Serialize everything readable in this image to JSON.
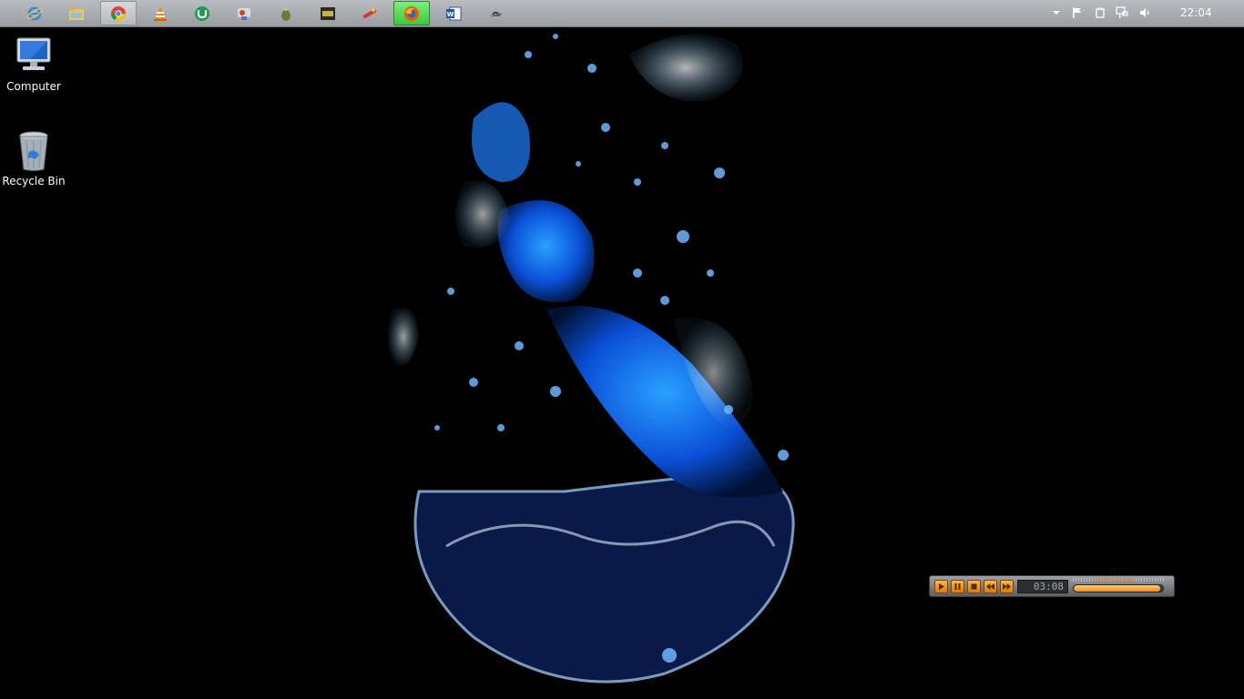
{
  "taskbar": {
    "apps": [
      {
        "name": "internet-explorer",
        "icon": "ie-icon"
      },
      {
        "name": "file-explorer",
        "icon": "folder-icon"
      },
      {
        "name": "chrome",
        "icon": "chrome-icon",
        "active": true
      },
      {
        "name": "vlc",
        "icon": "vlc-cone-icon"
      },
      {
        "name": "utorrent",
        "icon": "utorrent-icon"
      },
      {
        "name": "app-5",
        "icon": "paint-icon"
      },
      {
        "name": "app-6",
        "icon": "fruit-icon"
      },
      {
        "name": "app-7",
        "icon": "game-icon"
      },
      {
        "name": "app-8",
        "icon": "pen-icon"
      },
      {
        "name": "firefox",
        "icon": "firefox-icon",
        "highlighted": true
      },
      {
        "name": "word",
        "icon": "word-icon"
      },
      {
        "name": "app-11",
        "icon": "hat-icon"
      }
    ],
    "tray": {
      "icons": [
        "chevron-up-icon",
        "flag-icon",
        "power-icon",
        "network-icon",
        "speaker-icon"
      ],
      "time": "22:04"
    }
  },
  "desktop": {
    "icons": [
      {
        "label": "Computer",
        "icon": "computer-icon"
      },
      {
        "label": "Recycle Bin",
        "icon": "recycle-bin-icon"
      }
    ]
  },
  "player": {
    "buttons": [
      "play-icon",
      "pause-icon",
      "stop-icon",
      "rewind-icon",
      "fast-forward-icon"
    ],
    "time": "03:08",
    "volume_fraction": 0.97,
    "accent": "#ff8a00"
  }
}
